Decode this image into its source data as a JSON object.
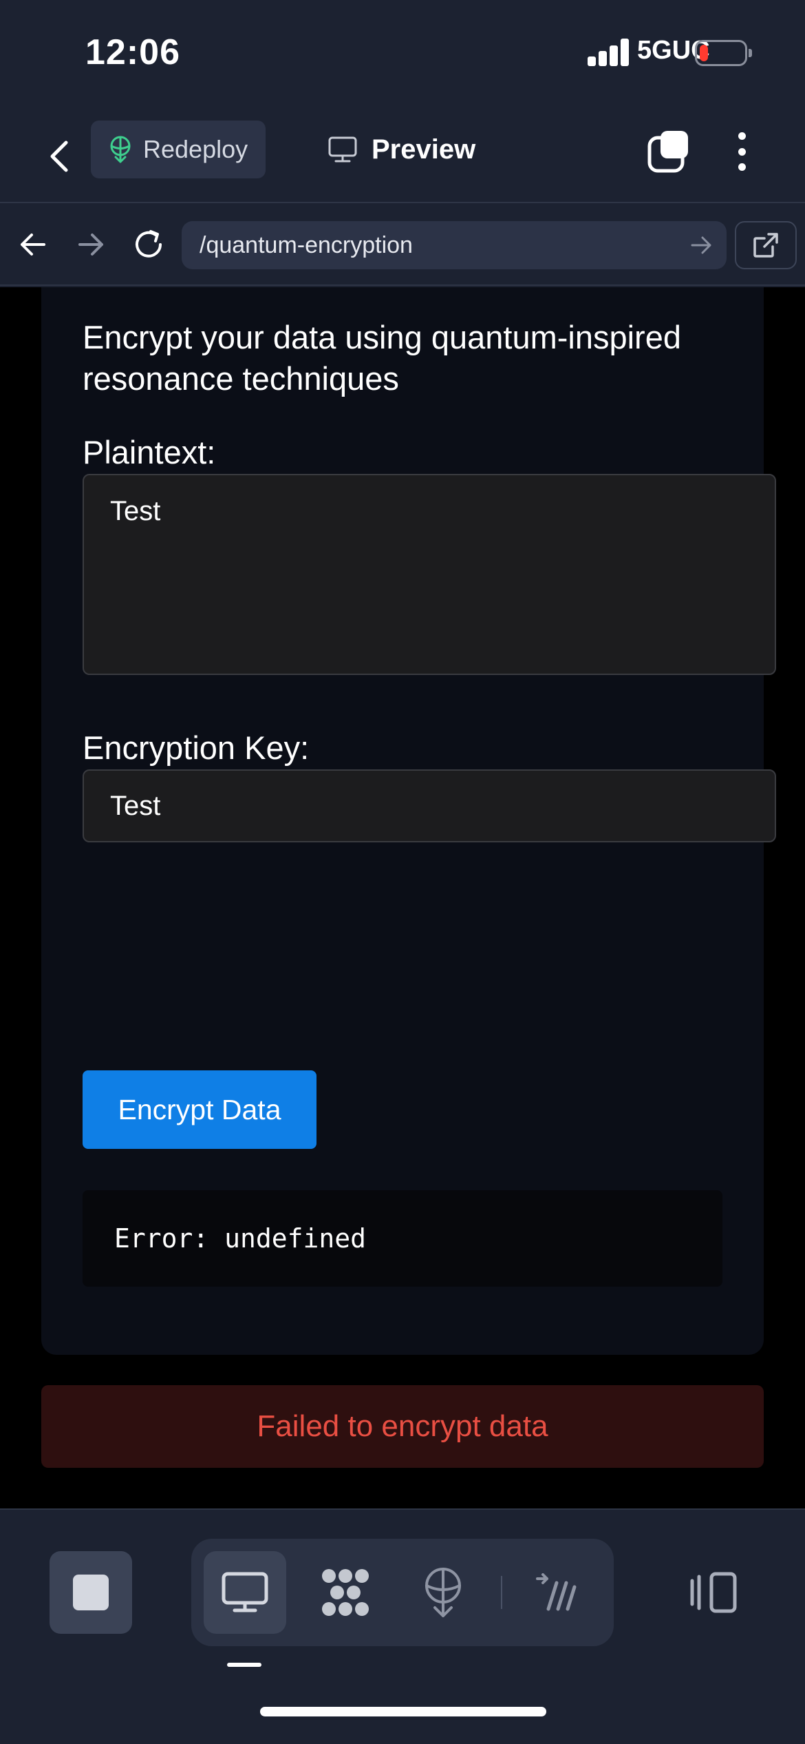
{
  "status_bar": {
    "time": "12:06",
    "network": "5GUC"
  },
  "header": {
    "redeploy_label": "Redeploy",
    "preview_label": "Preview"
  },
  "url_bar": {
    "path": "/quantum-encryption"
  },
  "page": {
    "intro": "Encrypt your data using quantum-inspired resonance techniques",
    "plaintext_label": "Plaintext:",
    "plaintext_value": "Test",
    "key_label": "Encryption Key:",
    "key_value": "Test",
    "encrypt_button": "Encrypt Data",
    "output_text": "Error: undefined",
    "error_banner": "Failed to encrypt data"
  },
  "colors": {
    "accent": "#0f7fe6",
    "error_text": "#e94f43",
    "error_bg": "#2e0f0f",
    "chrome_bg": "#1c2231",
    "redeploy_icon": "#3ecf8e"
  },
  "icons": {
    "back": "chevron-left-icon",
    "redeploy": "deploy-icon",
    "preview": "monitor-icon",
    "tabs": "tabs-icon",
    "more": "more-vertical-icon",
    "nav_back": "arrow-left-icon",
    "nav_forward": "arrow-right-icon",
    "reload": "reload-icon",
    "go": "arrow-right-icon",
    "external": "external-link-icon",
    "toolbar": [
      "stop-icon",
      "monitor-icon",
      "workflow-icon",
      "deploy-icon",
      "shell-icon",
      "split-panel-icon"
    ]
  }
}
